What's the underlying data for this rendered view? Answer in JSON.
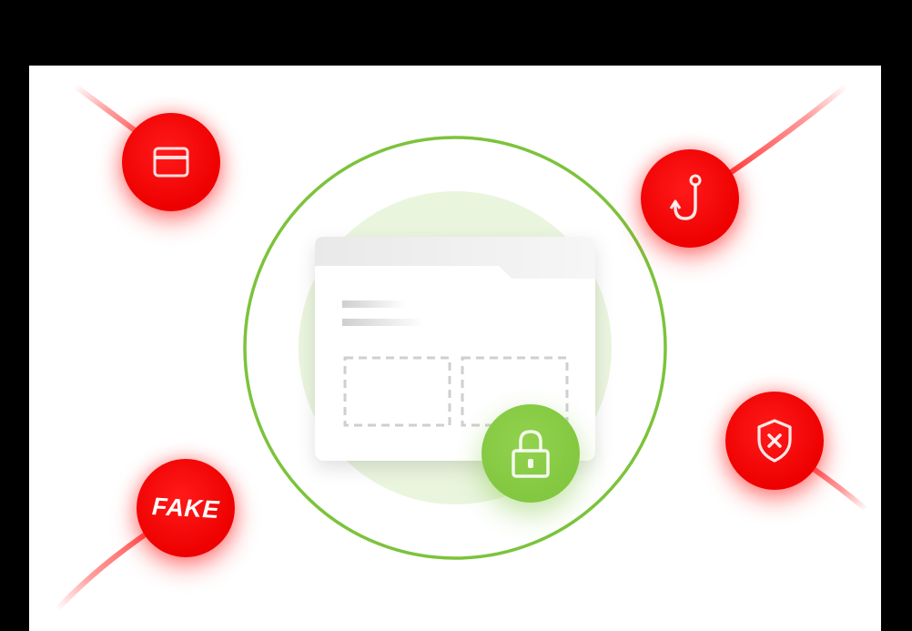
{
  "illustration": {
    "threats": [
      {
        "id": "credit-card",
        "icon": "credit-card-icon"
      },
      {
        "id": "phishing",
        "icon": "fishing-hook-icon"
      },
      {
        "id": "fake",
        "label": "FAKE"
      },
      {
        "id": "blocked",
        "icon": "shield-x-icon"
      }
    ],
    "protected": {
      "icon": "padlock-icon"
    }
  },
  "colors": {
    "threat_red": "#ee0000",
    "protect_green": "#7cc33b",
    "ring_green": "#7cc33b",
    "halo_green": "#e6f3d8",
    "background": "#ffffff",
    "frame": "#000000"
  }
}
